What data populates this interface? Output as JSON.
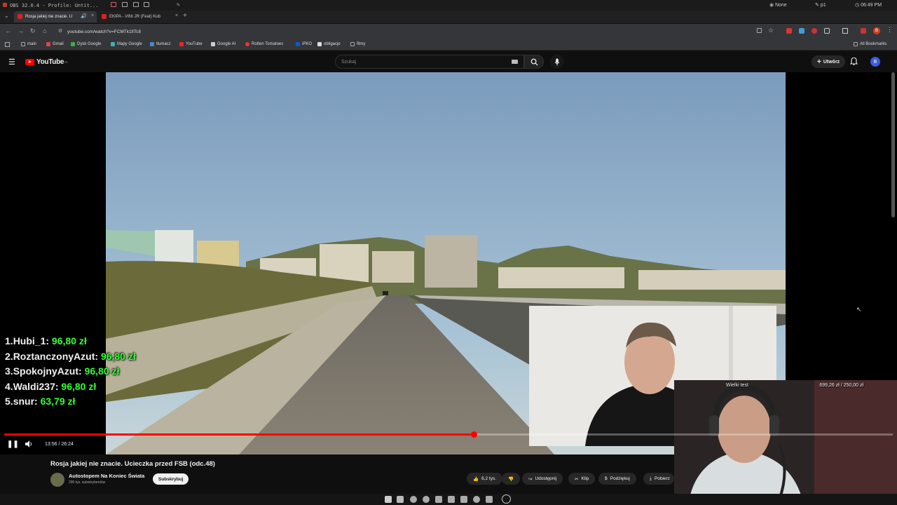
{
  "os": {
    "title": "OBS 32.0.4 - Profile: Untit...",
    "tray_none": "None",
    "tray_p1": "p1",
    "clock": "06:49 PM"
  },
  "browser": {
    "tabs": [
      {
        "label": "Rosja jakiej nie znacie. U"
      },
      {
        "label": "EKIPA - VINI JR (Feat) Kub"
      }
    ],
    "url": "youtube.com/watch?v=FCMTk1fiTc8",
    "bookmarks": [
      {
        "label": "main"
      },
      {
        "label": "Gmail"
      },
      {
        "label": "Dysk Google"
      },
      {
        "label": "Mapy Google"
      },
      {
        "label": "tłumacz"
      },
      {
        "label": "YouTube"
      },
      {
        "label": "Google AI"
      },
      {
        "label": "Rotten Tomatoes"
      },
      {
        "label": "iPKO"
      },
      {
        "label": "obligacje"
      },
      {
        "label": "filmy"
      }
    ],
    "all_bookmarks": "All Bookmarks"
  },
  "youtube": {
    "logo": "YouTube",
    "logo_region": "PL",
    "search_placeholder": "Szukaj",
    "create_label": "Utwórz",
    "avatar_letter": "B"
  },
  "player": {
    "time_current": "13:56",
    "time_sep": " / ",
    "time_total": "26:24",
    "progress_fraction": 0.528
  },
  "leaderboard": [
    {
      "rank": "1.",
      "name": "Hubi_1:",
      "amount": "96,80 zł"
    },
    {
      "rank": "2.",
      "name": "RoztanczonyAzut:",
      "amount": "96,80 zł"
    },
    {
      "rank": "3.",
      "name": "SpokojnyAzut:",
      "amount": "96,80 zł"
    },
    {
      "rank": "4.",
      "name": "Waldi237:",
      "amount": "96,80 zł"
    },
    {
      "rank": "5.",
      "name": "snur:",
      "amount": "63,79 zł"
    }
  ],
  "goal": {
    "label": "Wielki test",
    "value": "699,26 zł / 250,00 zł"
  },
  "video_info": {
    "title": "Rosja jakiej nie znacie. Ucieczka przed FSB (odc.48)",
    "channel": "Autostopem Na Koniec Świata",
    "subscribers": "290 tys. subskrybentów",
    "subscribe_label": "Subskrybuj",
    "likes": "6,2 tys.",
    "share_label": "Udostępnij",
    "clip_label": "Klip",
    "thanks_label": "Podziękuj",
    "download_label": "Pobierz"
  },
  "colors": {
    "yt_red": "#ff0000",
    "donation_green": "#33ff33",
    "background": "#0f0f0f"
  }
}
